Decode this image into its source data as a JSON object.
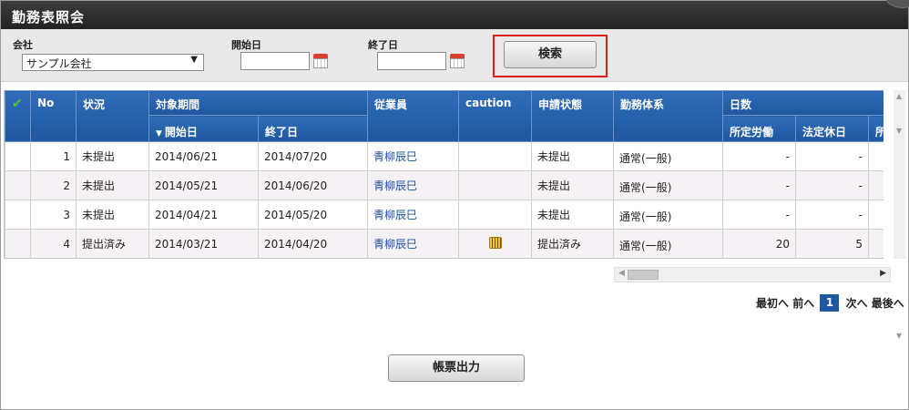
{
  "window": {
    "title": "勤務表照会"
  },
  "search": {
    "company_label": "会社",
    "company_value": "サンプル会社",
    "start_label": "開始日",
    "end_label": "終了日",
    "search_button": "検索"
  },
  "table": {
    "headers": {
      "no": "No",
      "status": "状況",
      "period": "対象期間",
      "start": "開始日",
      "end": "終了日",
      "employee": "従業員",
      "caution": "caution",
      "application": "申請状態",
      "work_system": "勤務体系",
      "days": "日数",
      "prescribed_work": "所定労働",
      "legal_holiday": "法定休日",
      "prescribed_cut": "所定"
    },
    "rows": [
      {
        "no": "1",
        "status": "未提出",
        "start": "2014/06/21",
        "end": "2014/07/20",
        "employee": "青柳辰巳",
        "caution": "",
        "application": "未提出",
        "work_system": "通常(一般)",
        "prescribed_work": "-",
        "legal_holiday": "-"
      },
      {
        "no": "2",
        "status": "未提出",
        "start": "2014/05/21",
        "end": "2014/06/20",
        "employee": "青柳辰巳",
        "caution": "",
        "application": "未提出",
        "work_system": "通常(一般)",
        "prescribed_work": "-",
        "legal_holiday": "-"
      },
      {
        "no": "3",
        "status": "未提出",
        "start": "2014/04/21",
        "end": "2014/05/20",
        "employee": "青柳辰巳",
        "caution": "",
        "application": "未提出",
        "work_system": "通常(一般)",
        "prescribed_work": "-",
        "legal_holiday": "-"
      },
      {
        "no": "4",
        "status": "提出済み",
        "start": "2014/03/21",
        "end": "2014/04/20",
        "employee": "青柳辰巳",
        "caution": "caution-icon",
        "application": "提出済み",
        "work_system": "通常(一般)",
        "prescribed_work": "20",
        "legal_holiday": "5"
      }
    ]
  },
  "pager": {
    "first": "最初へ",
    "prev": "前へ",
    "current": "1",
    "next": "次へ",
    "last": "最後へ"
  },
  "report_button": "帳票出力",
  "icons": {
    "check": "check-icon",
    "calendar": "calendar-icon",
    "sort": "sort-desc-icon",
    "caution": "caution-icon"
  },
  "colors": {
    "header_blue": "#1f57a0",
    "highlight_red": "#e01b1b",
    "link_blue": "#1b4f9a"
  }
}
